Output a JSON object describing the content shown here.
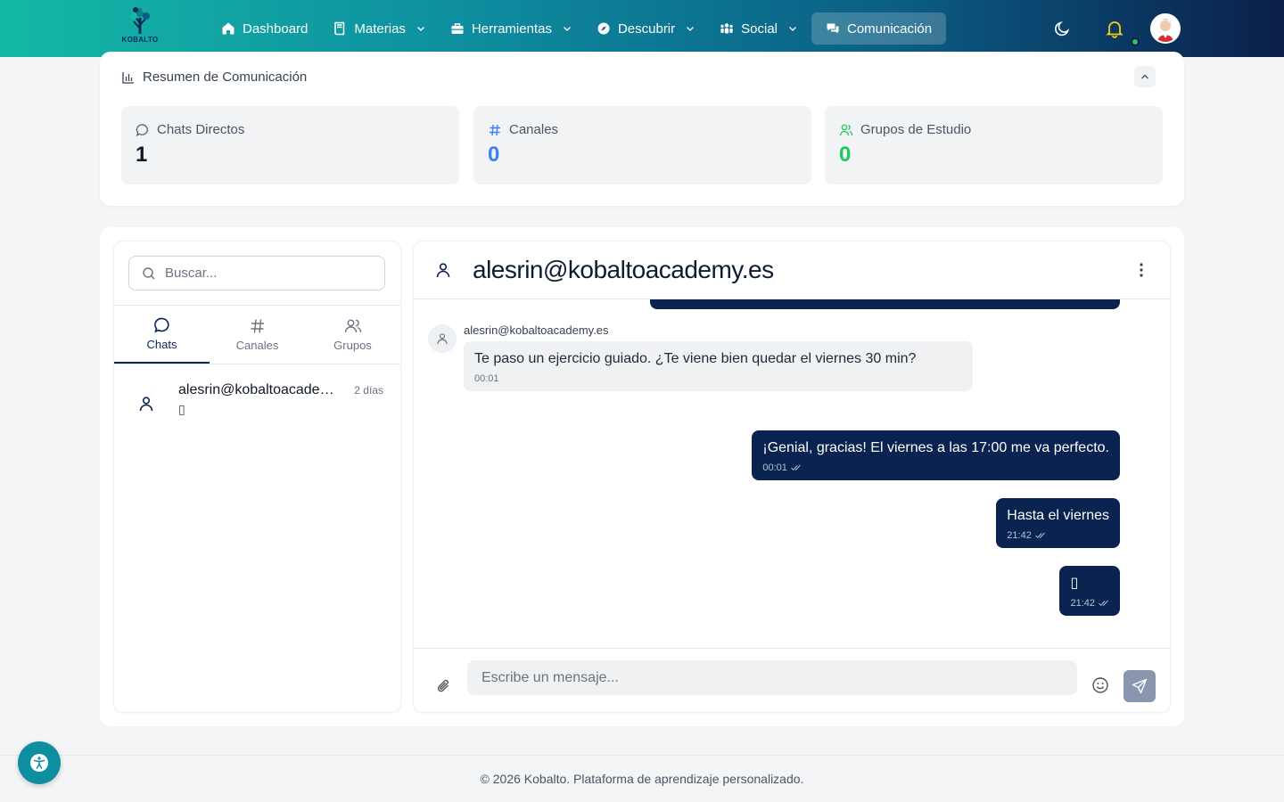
{
  "logo": {
    "text": "KOBALTO"
  },
  "nav": {
    "items": [
      {
        "label": "Dashboard",
        "icon": "home-icon"
      },
      {
        "label": "Materias",
        "icon": "book-icon"
      },
      {
        "label": "Herramientas",
        "icon": "toolbox-icon"
      },
      {
        "label": "Descubrir",
        "icon": "compass-icon"
      },
      {
        "label": "Social",
        "icon": "users-icon"
      },
      {
        "label": "Comunicación",
        "icon": "comments-icon",
        "active": true
      }
    ]
  },
  "summary": {
    "title": "Resumen de Comunicación",
    "stats": [
      {
        "label": "Chats Directos",
        "value": "1",
        "color": "#111827"
      },
      {
        "label": "Canales",
        "value": "0",
        "color": "#3b82f6"
      },
      {
        "label": "Grupos de Estudio",
        "value": "0",
        "color": "#22c55e"
      }
    ]
  },
  "sidebar": {
    "search_placeholder": "Buscar...",
    "tabs": [
      {
        "label": "Chats"
      },
      {
        "label": "Canales"
      },
      {
        "label": "Grupos"
      }
    ],
    "chats": [
      {
        "name": "alesrin@kobaltoacademy.es",
        "time": "2 días",
        "preview": "▯"
      }
    ]
  },
  "conversation": {
    "title": "alesrin@kobaltoacademy.es",
    "incoming": {
      "sender": "alesrin@kobaltoacademy.es",
      "text": "Te paso un ejercicio guiado. ¿Te viene bien quedar el viernes 30 min?",
      "time": "00:01"
    },
    "outgoing": [
      {
        "text": "¡Genial, gracias! El viernes a las 17:00 me va perfecto.",
        "time": "00:01"
      },
      {
        "text": "Hasta el viernes",
        "time": "21:42"
      },
      {
        "text": "▯",
        "time": "21:42"
      }
    ],
    "input_placeholder": "Escribe un mensaje..."
  },
  "footer": {
    "text": "© 2026 Kobalto. Plataforma de aprendizaje personalizado."
  },
  "colors": {
    "brand_dark": "#0a2350",
    "brand_teal": "#14b8a6",
    "accent_blue": "#3b82f6",
    "accent_green": "#22c55e"
  }
}
